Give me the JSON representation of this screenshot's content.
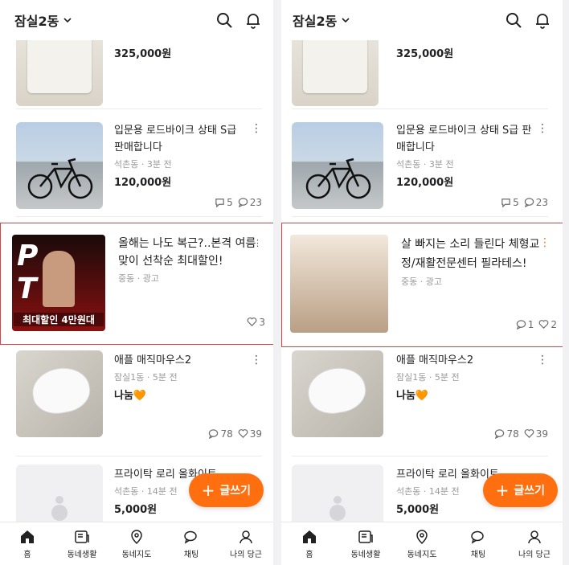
{
  "location": "잠실2동",
  "left": {
    "items": [
      {
        "title": "",
        "meta": "",
        "price": "325,000원",
        "image": "bag"
      },
      {
        "title": "입문용 로드바이크 상태 S급 판매합니다",
        "meta": "석촌동 · 3분 전",
        "price": "120,000원",
        "comments": "5",
        "chats": "23",
        "image": "bike"
      },
      {
        "title": "애플 매직마우스2",
        "meta": "잠실1동 · 5분 전",
        "price": "나눔🧡",
        "comments": "78",
        "likes": "39",
        "image": "mouse"
      },
      {
        "title": "프라이탁 로리 올화이트",
        "meta": "석촌동 · 14분 전",
        "price": "5,000원",
        "image": "placeholder"
      }
    ],
    "ad": {
      "title": "올해는 나도 복근?..본격 여름맞이 선착순 최대할인!",
      "meta": "중동 · 광고",
      "likes": "3",
      "thumb_text": "P T",
      "thumb_banner": "최대할인 4만원대"
    }
  },
  "right": {
    "items": [
      {
        "title": "",
        "meta": "",
        "price": "325,000원",
        "image": "bag"
      },
      {
        "title": "입문용 로드바이크 상태 S급 판매합니다",
        "meta": "석촌동 · 3분 전",
        "price": "120,000원",
        "comments": "5",
        "chats": "23",
        "image": "bike"
      },
      {
        "title": "애플 매직마우스2",
        "meta": "잠실1동 · 5분 전",
        "price": "나눔🧡",
        "comments": "78",
        "likes": "39",
        "image": "mouse"
      },
      {
        "title": "프라이탁 로리 올화이트",
        "meta": "석촌동 · 14분 전",
        "price": "5,000원",
        "image": "placeholder"
      }
    ],
    "ad": {
      "title": "살 빠지는 소리 들린다 체형교정/재활전문센터 필라테스!",
      "meta": "중동 · 광고",
      "comments": "1",
      "likes": "2"
    }
  },
  "fab_label": "글쓰기",
  "nav": [
    "홈",
    "동네생활",
    "동네지도",
    "채팅",
    "나의 당근"
  ],
  "accent": "#ff6f0f",
  "ad_border": "#d64545"
}
